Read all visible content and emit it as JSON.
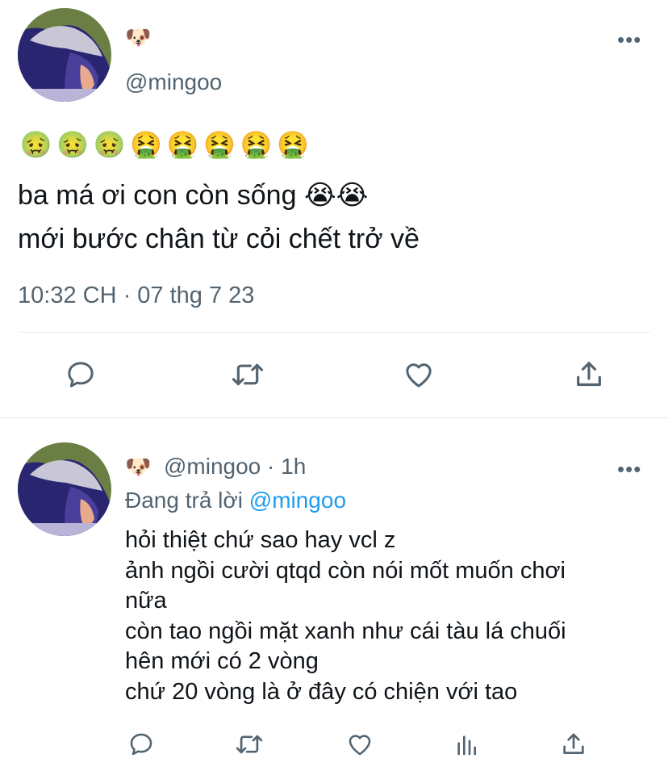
{
  "main_tweet": {
    "display_name": "🐶",
    "handle": "@mingoo",
    "emoji_line": [
      "🤢",
      "🤢",
      "🤢",
      "🤮",
      "🤮",
      "🤮",
      "🤮",
      "🤮"
    ],
    "text_lines": [
      "ba má ơi con còn sống 😭😭",
      "mới bước chân từ cỏi chết trở về"
    ],
    "timestamp": "10:32 CH · 07 thg 7 23",
    "actions": [
      "reply-icon",
      "retweet-icon",
      "like-icon",
      "share-icon"
    ]
  },
  "reply_tweet": {
    "display_name": "🐶",
    "handle_time": "@mingoo · 1h",
    "replying_prefix": "Đang trả lời",
    "replying_to": "@mingoo",
    "text_lines": [
      "hỏi thiệt chứ sao hay vcl z",
      "ảnh ngồi cười qtqd còn nói mốt muốn chơi",
      "nữa",
      "còn tao ngồi mặt xanh như cái tàu lá chuối",
      "hên mới có 2 vòng",
      "chứ 20 vòng là ở đây có chiện với tao"
    ],
    "actions": [
      "reply-icon",
      "retweet-icon",
      "like-icon",
      "analytics-icon",
      "share-icon"
    ]
  },
  "more_label": "•••",
  "colors": {
    "secondary_text": "#536471",
    "link": "#1d9bf0",
    "divider": "#e6ecf0"
  }
}
